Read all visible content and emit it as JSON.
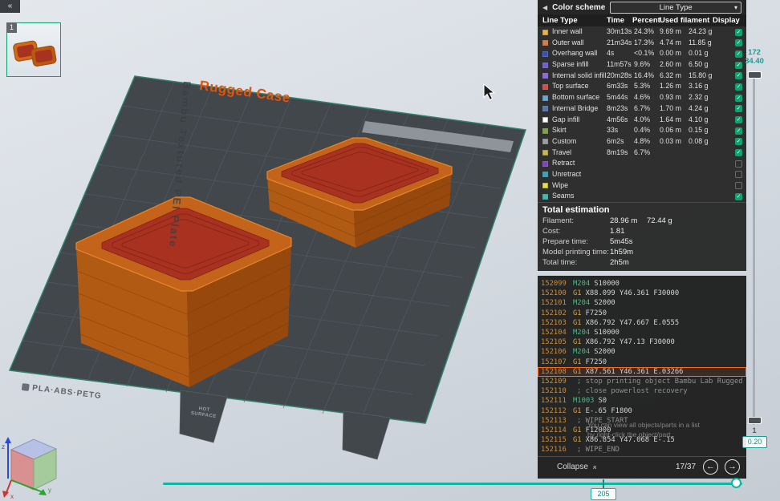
{
  "topbar": {
    "collapse_glyph": "«"
  },
  "viewport": {
    "plate_number": "1",
    "object_label": "Rugged Case",
    "plate_label": "Bambu Textured PEI Plate",
    "plate_material_label": "PLA·ABS·PETG",
    "hot_line1": "HOT",
    "hot_line2": "SURFACE",
    "nav_axes": {
      "x": "x",
      "y": "y",
      "z": "z"
    }
  },
  "color_scheme": {
    "collapse_icon": "◀",
    "title": "Color scheme",
    "selected": "Line Type",
    "caret": "▾"
  },
  "legend": {
    "columns": [
      "Line Type",
      "Time",
      "Percent",
      "Used filament",
      "Display"
    ],
    "rows": [
      {
        "label": "Inner wall",
        "color": "#EDB33D",
        "time": "30m13s",
        "percent": "24.3%",
        "used_m": "9.69 m",
        "used_g": "24.23 g",
        "checked": true
      },
      {
        "label": "Outer wall",
        "color": "#E2793B",
        "time": "21m34s",
        "percent": "17.3%",
        "used_m": "4.74 m",
        "used_g": "11.85 g",
        "checked": true
      },
      {
        "label": "Overhang wall",
        "color": "#3050C8",
        "time": "4s",
        "percent": "<0.1%",
        "used_m": "0.00 m",
        "used_g": "0.01 g",
        "checked": true
      },
      {
        "label": "Sparse infill",
        "color": "#6E5BE0",
        "time": "11m57s",
        "percent": "9.6%",
        "used_m": "2.60 m",
        "used_g": "6.50 g",
        "checked": true
      },
      {
        "label": "Internal solid infill",
        "color": "#8F66E8",
        "time": "20m28s",
        "percent": "16.4%",
        "used_m": "6.32 m",
        "used_g": "15.80 g",
        "checked": true
      },
      {
        "label": "Top surface",
        "color": "#E04848",
        "time": "6m33s",
        "percent": "5.3%",
        "used_m": "1.26 m",
        "used_g": "3.16 g",
        "checked": true
      },
      {
        "label": "Bottom surface",
        "color": "#63A8DF",
        "time": "5m44s",
        "percent": "4.6%",
        "used_m": "0.93 m",
        "used_g": "2.32 g",
        "checked": true
      },
      {
        "label": "Internal Bridge",
        "color": "#4A7BB8",
        "time": "8m23s",
        "percent": "6.7%",
        "used_m": "1.70 m",
        "used_g": "4.24 g",
        "checked": true
      },
      {
        "label": "Gap infill",
        "color": "#FFFFFF",
        "time": "4m56s",
        "percent": "4.0%",
        "used_m": "1.64 m",
        "used_g": "4.10 g",
        "checked": true
      },
      {
        "label": "Skirt",
        "color": "#7DA83F",
        "time": "33s",
        "percent": "0.4%",
        "used_m": "0.06 m",
        "used_g": "0.15 g",
        "checked": true
      },
      {
        "label": "Custom",
        "color": "#9E9E9E",
        "time": "6m2s",
        "percent": "4.8%",
        "used_m": "0.03 m",
        "used_g": "0.08 g",
        "checked": true
      },
      {
        "label": "Travel",
        "color": "#C8B83C",
        "time": "8m19s",
        "percent": "6.7%",
        "used_m": "",
        "used_g": "",
        "checked": true
      },
      {
        "label": "Retract",
        "color": "#8040C8",
        "time": "",
        "percent": "",
        "used_m": "",
        "used_g": "",
        "checked": false
      },
      {
        "label": "Unretract",
        "color": "#2CA8C8",
        "time": "",
        "percent": "",
        "used_m": "",
        "used_g": "",
        "checked": false
      },
      {
        "label": "Wipe",
        "color": "#E8E23C",
        "time": "",
        "percent": "",
        "used_m": "",
        "used_g": "",
        "checked": false
      },
      {
        "label": "Seams",
        "color": "#30C0B4",
        "time": "",
        "percent": "",
        "used_m": "",
        "used_g": "",
        "checked": true
      }
    ]
  },
  "totals": {
    "title": "Total estimation",
    "rows": [
      {
        "label": "Filament:",
        "value": "28.96 m",
        "value2": "72.44 g"
      },
      {
        "label": "Cost:",
        "value": "1.81",
        "value2": ""
      },
      {
        "label": "Prepare time:",
        "value": "5m45s",
        "value2": ""
      },
      {
        "label": "Model printing time:",
        "value": "1h59m",
        "value2": ""
      },
      {
        "label": "Total time:",
        "value": "2h5m",
        "value2": ""
      }
    ]
  },
  "gcode": {
    "lines": [
      {
        "num": "152099",
        "cmd": "M204",
        "rest": "S10000",
        "kind": "m"
      },
      {
        "num": "152100",
        "cmd": "G1",
        "rest": "X88.099 Y46.361 F30000",
        "kind": "g"
      },
      {
        "num": "152101",
        "cmd": "M204",
        "rest": "S2000",
        "kind": "m"
      },
      {
        "num": "152102",
        "cmd": "G1",
        "rest": "F7250",
        "kind": "g"
      },
      {
        "num": "152103",
        "cmd": "G1",
        "rest": "X86.792 Y47.667 E.0555",
        "kind": "g"
      },
      {
        "num": "152104",
        "cmd": "M204",
        "rest": "S10000",
        "kind": "m"
      },
      {
        "num": "152105",
        "cmd": "G1",
        "rest": "X86.792 Y47.13 F30000",
        "kind": "g"
      },
      {
        "num": "152106",
        "cmd": "M204",
        "rest": "S2000",
        "kind": "m"
      },
      {
        "num": "152107",
        "cmd": "G1",
        "rest": "F7250",
        "kind": "g"
      },
      {
        "num": "152108",
        "cmd": "G1",
        "rest": "X87.561 Y46.361 E.03266",
        "kind": "g",
        "current": true
      },
      {
        "num": "152109",
        "cmd": "",
        "rest": "; stop printing object Bambu Lab Rugged Case.stl id...",
        "kind": "c"
      },
      {
        "num": "152110",
        "cmd": "",
        "rest": "; close powerlost recovery",
        "kind": "c"
      },
      {
        "num": "152111",
        "cmd": "M1003",
        "rest": "S0",
        "kind": "m"
      },
      {
        "num": "152112",
        "cmd": "G1",
        "rest": "E-.65 F1800",
        "kind": "g"
      },
      {
        "num": "152113",
        "cmd": "",
        "rest": "; WIPE_START",
        "kind": "c"
      },
      {
        "num": "152114",
        "cmd": "G1",
        "rest": "F12000",
        "kind": "g"
      },
      {
        "num": "152115",
        "cmd": "G1",
        "rest": "X86.854 Y47.068 E-.15",
        "kind": "g"
      },
      {
        "num": "152116",
        "cmd": "",
        "rest": "; WIPE_END",
        "kind": "c"
      }
    ],
    "tip_line1": "You can view all objects/parts in a list",
    "tip_line2": "by right-click the object/part",
    "collapse_label": "Collapse",
    "collapse_icon": "»",
    "page": "17/37",
    "prev_icon": "←",
    "next_icon": "→"
  },
  "sliders": {
    "layer": {
      "top_value": "172",
      "top_height": "34.40",
      "bottom_value": "1",
      "bottom_height": "0.20"
    },
    "move": {
      "value": "205"
    }
  },
  "colors": {
    "accent_teal": "#12B5A2",
    "bambu_green": "#12A06E",
    "highlight_orange": "#FF6A1E",
    "object_orange": "#E2540A"
  }
}
